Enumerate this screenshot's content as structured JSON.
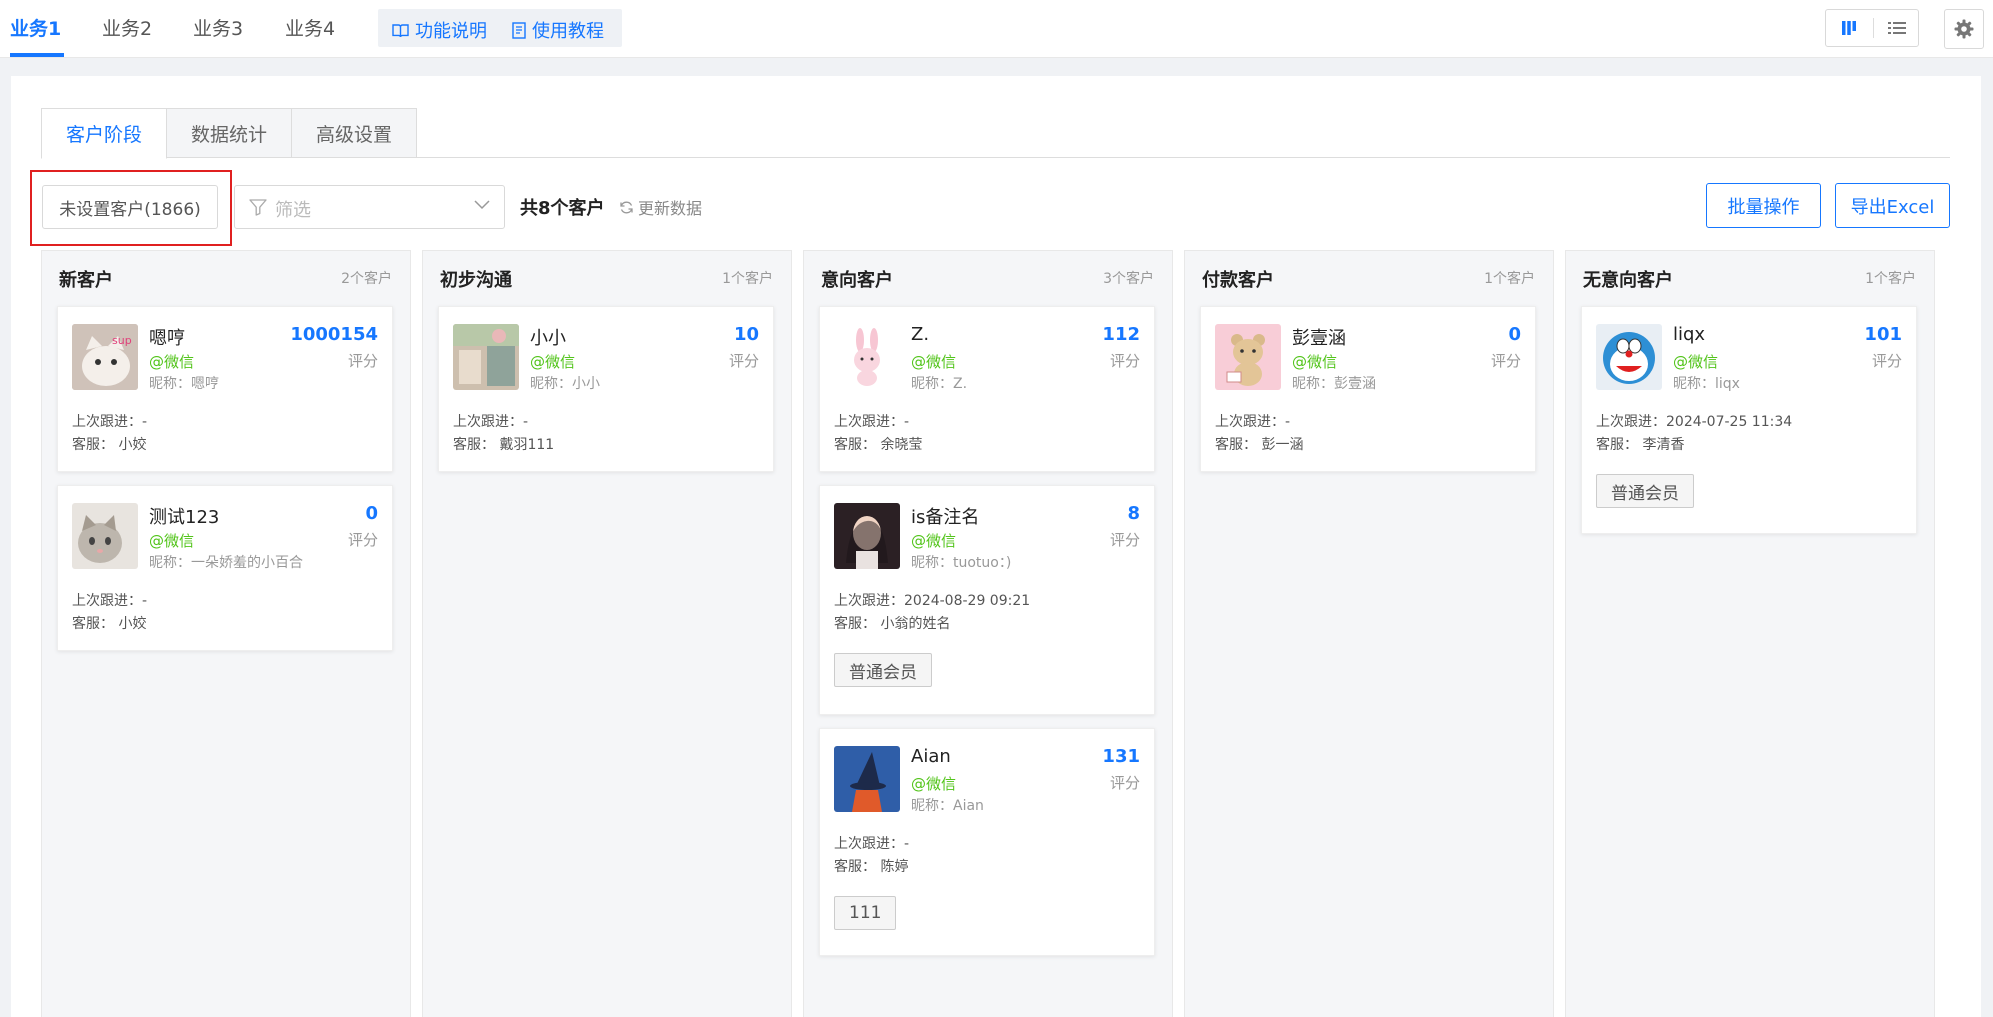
{
  "topnav": {
    "items": [
      {
        "label": "业务1",
        "active": true
      },
      {
        "label": "业务2"
      },
      {
        "label": "业务3"
      },
      {
        "label": "业务4"
      }
    ],
    "help_links": [
      {
        "label": "功能说明",
        "icon": "book-icon"
      },
      {
        "label": "使用教程",
        "icon": "document-icon"
      }
    ],
    "view_toggle": [
      {
        "icon": "kanban-icon",
        "active": true
      },
      {
        "icon": "list-icon"
      }
    ],
    "settings_icon": "gear-icon"
  },
  "tabs": [
    {
      "label": "客户阶段",
      "active": true
    },
    {
      "label": "数据统计"
    },
    {
      "label": "高级设置"
    }
  ],
  "toolbar": {
    "unset_label": "未设置客户(1866)",
    "filter_placeholder": "筛选",
    "total_label": "共8个客户",
    "refresh_label": "更新数据",
    "batch_label": "批量操作",
    "export_label": "导出Excel"
  },
  "columns": [
    {
      "title": "新客户",
      "count": "2个客户",
      "cards": [
        {
          "name": "嗯哼",
          "source": "@微信",
          "nickname": "昵称：嗯哼",
          "score": "1000154",
          "score_label": "评分",
          "last_follow": "上次跟进：-",
          "service": "客服：  小姣",
          "tag": "",
          "avatar_color": "#d7c9c2"
        },
        {
          "name": "测试123",
          "source": "@微信",
          "nickname": "昵称：一朵娇羞的小百合",
          "score": "0",
          "score_label": "评分",
          "last_follow": "上次跟进：-",
          "service": "客服：  小姣",
          "tag": "",
          "avatar_color": "#cfcac4"
        }
      ]
    },
    {
      "title": "初步沟通",
      "count": "1个客户",
      "cards": [
        {
          "name": "小小",
          "source": "@微信",
          "nickname": "昵称：小小",
          "score": "10",
          "score_label": "评分",
          "last_follow": "上次跟进：-",
          "service": "客服：  戴羽111",
          "tag": "",
          "avatar_color": "#c8b9a8"
        }
      ]
    },
    {
      "title": "意向客户",
      "count": "3个客户",
      "cards": [
        {
          "name": "Z.",
          "source": "@微信",
          "nickname": "昵称：Z.",
          "score": "112",
          "score_label": "评分",
          "last_follow": "上次跟进：-",
          "service": "客服：  余晓莹",
          "tag": "",
          "avatar_color": "#fbe3ea"
        },
        {
          "name": "is备注名",
          "source": "@微信",
          "nickname": "昵称：tuotuo：)",
          "score": "8",
          "score_label": "评分",
          "last_follow": "上次跟进：2024-08-29 09:21",
          "service": "客服：  小翁的姓名",
          "tag": "普通会员",
          "avatar_color": "#3a2a2a"
        },
        {
          "name": "Aian",
          "source": "@微信",
          "nickname": "昵称：Aian",
          "score": "131",
          "score_label": "评分",
          "last_follow": "上次跟进：-",
          "service": "客服：  陈婷",
          "tag": "111",
          "avatar_color": "#2f5ea8"
        }
      ]
    },
    {
      "title": "付款客户",
      "count": "1个客户",
      "cards": [
        {
          "name": "彭壹涵",
          "source": "@微信",
          "nickname": "昵称：彭壹涵",
          "score": "0",
          "score_label": "评分",
          "last_follow": "上次跟进：-",
          "service": "客服：  彭一涵",
          "tag": "",
          "avatar_color": "#f6c9d3"
        }
      ]
    },
    {
      "title": "无意向客户",
      "count": "1个客户",
      "cards": [
        {
          "name": "liqx",
          "source": "@微信",
          "nickname": "昵称：liqx",
          "score": "101",
          "score_label": "评分",
          "last_follow": "上次跟进：2024-07-25 11:34",
          "service": "客服：  李清香",
          "tag": "普通会员",
          "avatar_color": "#9cc9ea"
        }
      ]
    }
  ]
}
